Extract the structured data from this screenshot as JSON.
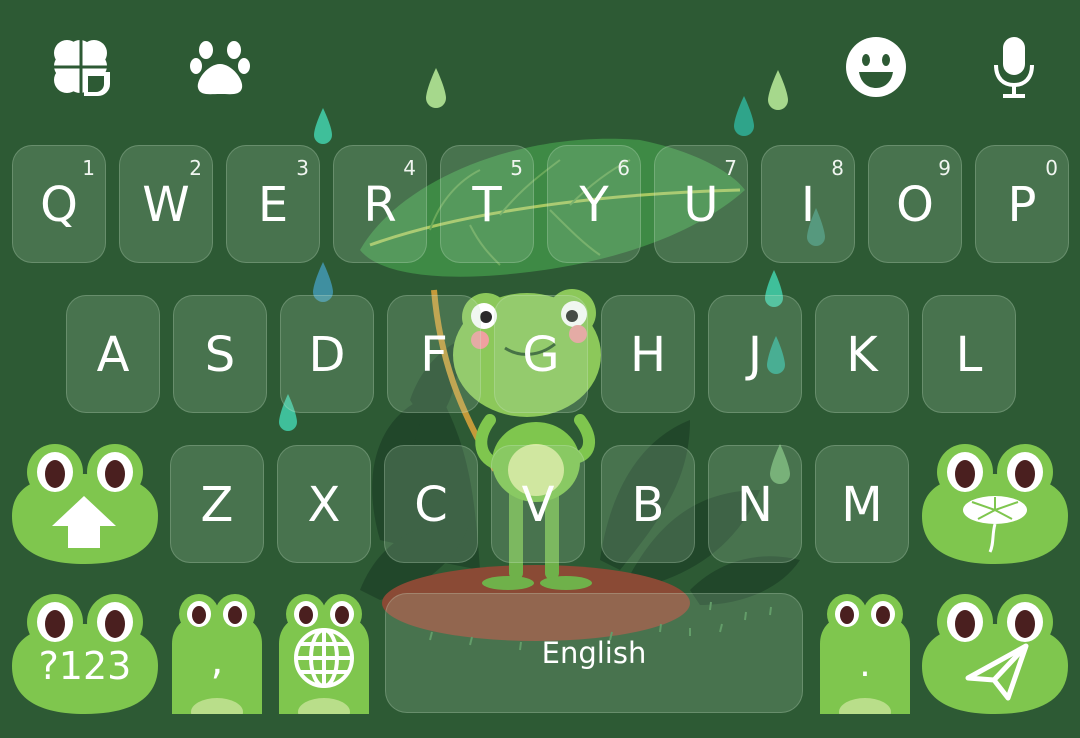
{
  "toolbar": {
    "left_icons": [
      "clover-heart-icon",
      "paw-icon"
    ],
    "right_icons": [
      "emoji-icon",
      "microphone-icon"
    ]
  },
  "rows": [
    [
      {
        "letter": "Q",
        "hint": "1"
      },
      {
        "letter": "W",
        "hint": "2"
      },
      {
        "letter": "E",
        "hint": "3"
      },
      {
        "letter": "R",
        "hint": "4"
      },
      {
        "letter": "T",
        "hint": "5"
      },
      {
        "letter": "Y",
        "hint": "6"
      },
      {
        "letter": "U",
        "hint": "7"
      },
      {
        "letter": "I",
        "hint": "8"
      },
      {
        "letter": "O",
        "hint": "9"
      },
      {
        "letter": "P",
        "hint": "0"
      }
    ],
    [
      {
        "letter": "A"
      },
      {
        "letter": "S"
      },
      {
        "letter": "D"
      },
      {
        "letter": "F"
      },
      {
        "letter": "G"
      },
      {
        "letter": "H"
      },
      {
        "letter": "J"
      },
      {
        "letter": "K"
      },
      {
        "letter": "L"
      }
    ],
    [
      {
        "letter": "Z"
      },
      {
        "letter": "X"
      },
      {
        "letter": "C"
      },
      {
        "letter": "V"
      },
      {
        "letter": "B"
      },
      {
        "letter": "N"
      },
      {
        "letter": "M"
      }
    ]
  ],
  "special_keys": {
    "shift_icon": "shift-arrow-icon",
    "backspace_icon": "lily-pad-backspace-icon",
    "symbols_label": "?123",
    "comma_label": ",",
    "language_icon": "globe-icon",
    "space_label": "English",
    "period_label": ".",
    "enter_icon": "send-icon"
  },
  "colors": {
    "background": "#2d5a34",
    "frog_green": "#7fc64e",
    "frog_belly": "#b9de8a",
    "key_text": "#ffffff"
  }
}
